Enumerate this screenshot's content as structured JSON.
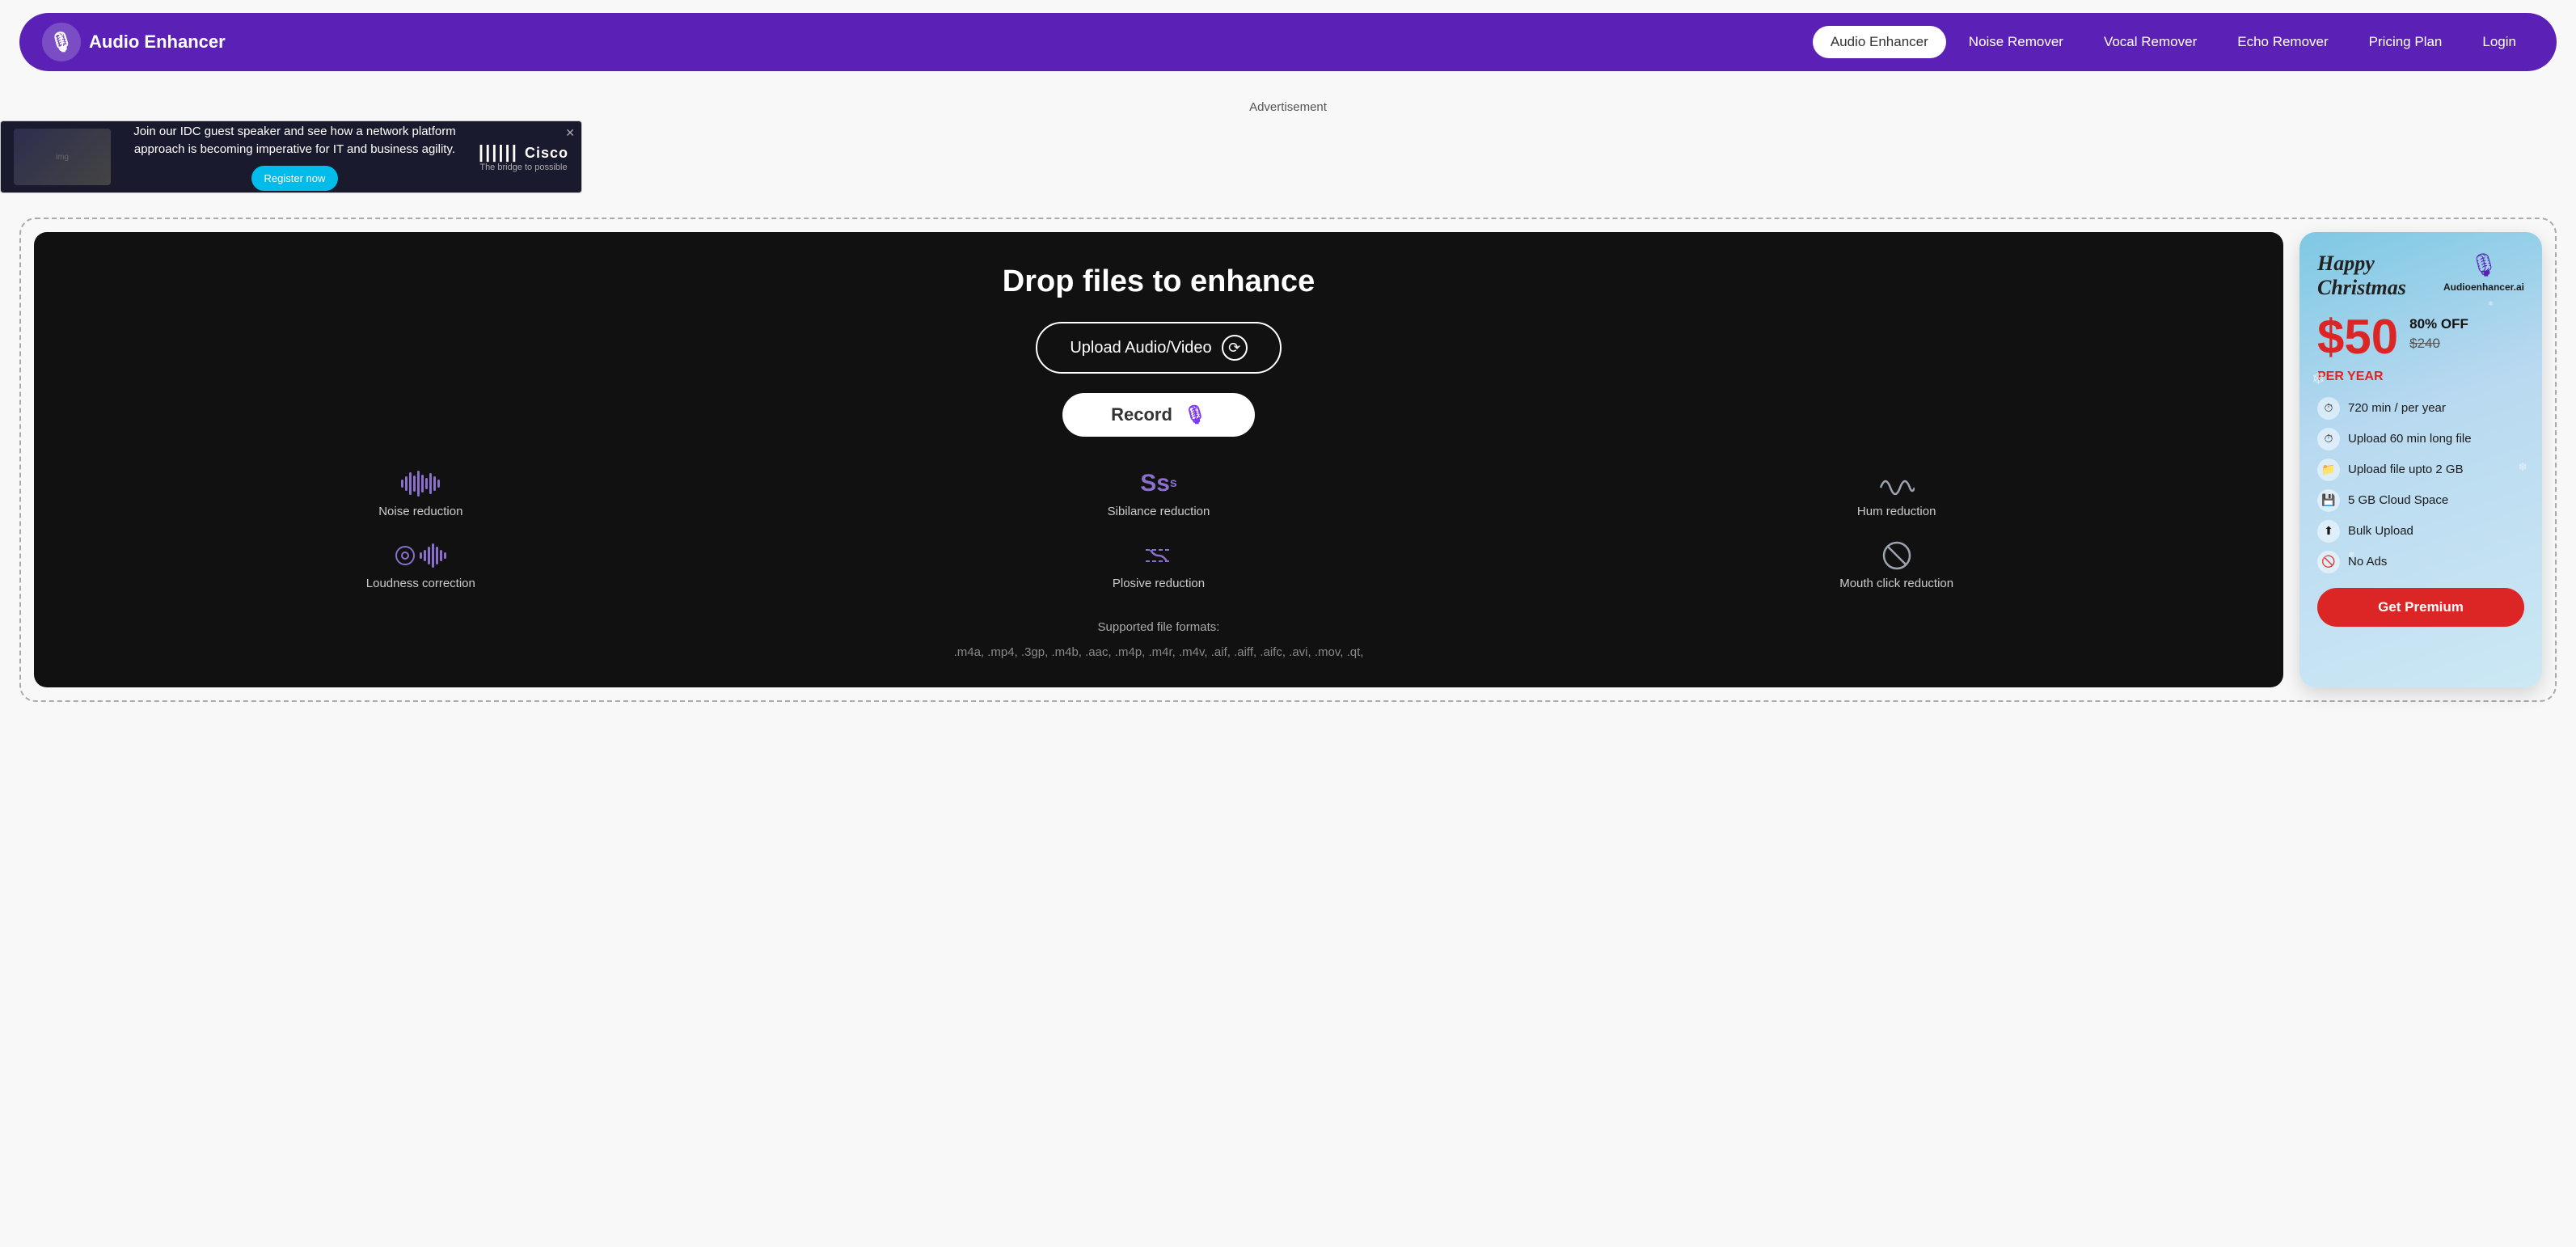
{
  "nav": {
    "logo_text": "Audio Enhancer",
    "links": [
      {
        "id": "audio-enhancer",
        "label": "Audio Enhancer",
        "active": true
      },
      {
        "id": "noise-remover",
        "label": "Noise Remover",
        "active": false
      },
      {
        "id": "vocal-remover",
        "label": "Vocal Remover",
        "active": false
      },
      {
        "id": "echo-remover",
        "label": "Echo Remover",
        "active": false
      },
      {
        "id": "pricing-plan",
        "label": "Pricing Plan",
        "active": false
      },
      {
        "id": "login",
        "label": "Login",
        "active": false
      }
    ]
  },
  "advertisement": {
    "label": "Advertisement",
    "ad_text": "Join our IDC guest speaker and see how a network platform approach is becoming imperative for IT and business agility.",
    "register_label": "Register now",
    "brand": "Cisco",
    "brand_sub": "The bridge to possible"
  },
  "upload_panel": {
    "drop_title": "Drop files to enhance",
    "upload_button_label": "Upload Audio/Video",
    "record_button_label": "Record",
    "features": [
      {
        "id": "noise-reduction",
        "label": "Noise reduction",
        "icon_type": "wave"
      },
      {
        "id": "sibilance-reduction",
        "label": "Sibilance reduction",
        "icon_type": "sibilance"
      },
      {
        "id": "hum-reduction",
        "label": "Hum reduction",
        "icon_type": "hum"
      },
      {
        "id": "loudness-correction",
        "label": "Loudness correction",
        "icon_type": "loudness"
      },
      {
        "id": "plosive-reduction",
        "label": "Plosive reduction",
        "icon_type": "plosive"
      },
      {
        "id": "mouth-click-reduction",
        "label": "Mouth click reduction",
        "icon_type": "mouth"
      }
    ],
    "formats_label": "Supported file formats:",
    "formats_text": ".m4a, .mp4, .3gp, .m4b, .aac, .m4p, .m4r, .m4v, .aif, .aiff, .aifc, .avi, .mov, .qt,"
  },
  "promo": {
    "xmas_text": "Happy\nChristmas",
    "logo_text": "Audioenhancer.ai",
    "price": "$50",
    "discount": "80% OFF",
    "original_price": "$240",
    "per_year": "PER YEAR",
    "features": [
      {
        "icon": "⏱",
        "text": "720 min / per year"
      },
      {
        "icon": "⏱",
        "text": "Upload 60 min long file"
      },
      {
        "icon": "📁",
        "text": "Upload file upto 2 GB"
      },
      {
        "icon": "💾",
        "text": "5 GB Cloud Space"
      },
      {
        "icon": "⬆",
        "text": "Bulk Upload"
      },
      {
        "icon": "🚫",
        "text": "No Ads"
      }
    ],
    "get_premium_label": "Get Premium"
  }
}
